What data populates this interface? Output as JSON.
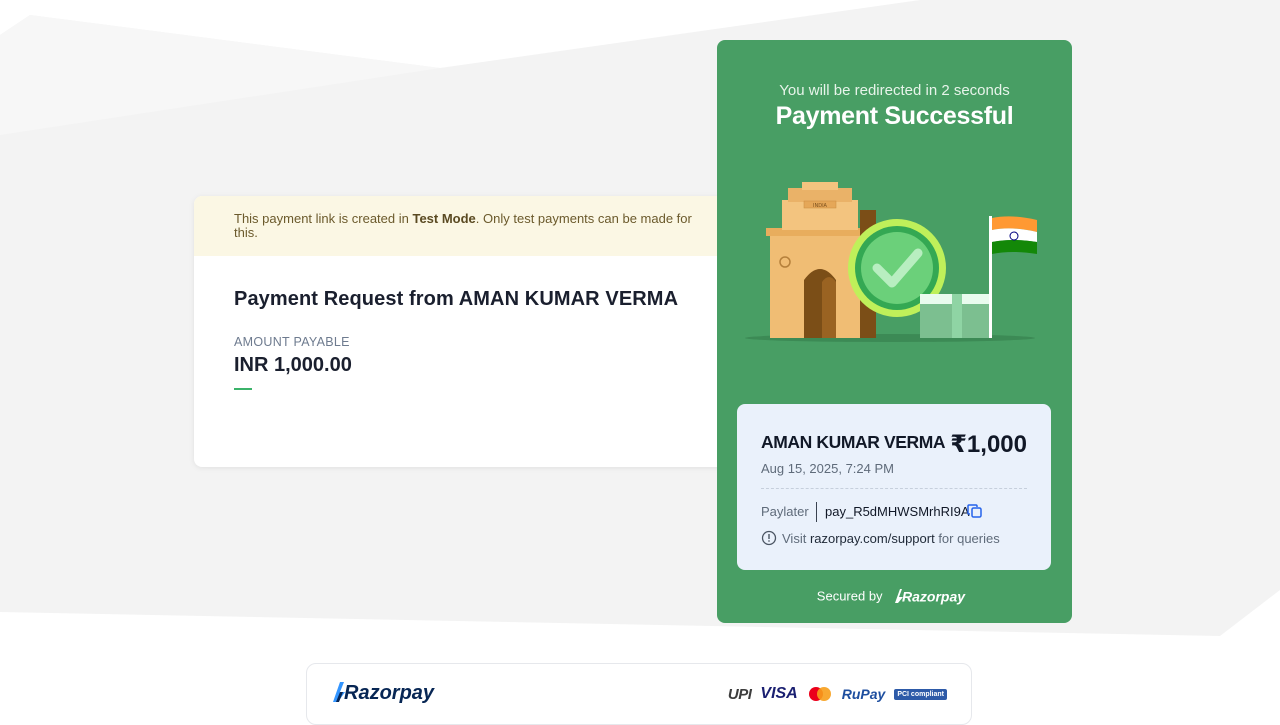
{
  "test_banner": {
    "prefix": "This payment link is created in ",
    "mode": "Test Mode",
    "suffix": ". Only test payments can be made for this."
  },
  "request": {
    "title": "Payment Request from AMAN KUMAR VERMA",
    "amount_label": "AMOUNT PAYABLE",
    "amount_value": "INR 1,000.00"
  },
  "success": {
    "redirect_text": "You will be redirected in 2 seconds",
    "title": "Payment Successful",
    "illustration_label": "INDIA",
    "payee": "AMAN KUMAR VERMA",
    "amount": "₹1,000",
    "date": "Aug 15, 2025, 7:24 PM",
    "method": "Paylater",
    "payment_id": "pay_R5dMHWSMrhRI9A",
    "support_prefix": "Visit ",
    "support_link": "razorpay.com/support",
    "support_suffix": " for queries",
    "secured_label": "Secured by",
    "brand": "Razorpay"
  },
  "footer": {
    "brand": "Razorpay",
    "logos": {
      "upi": "UPI",
      "visa": "VISA",
      "rupay": "RuPay",
      "pci": "PCI compliant"
    }
  },
  "colors": {
    "success_green": "#489e64",
    "receipt_bg": "#eaf1fb",
    "test_banner_bg": "#fbf7e4",
    "accent_green": "#3bb36a",
    "razorpay_blue": "#072654"
  }
}
